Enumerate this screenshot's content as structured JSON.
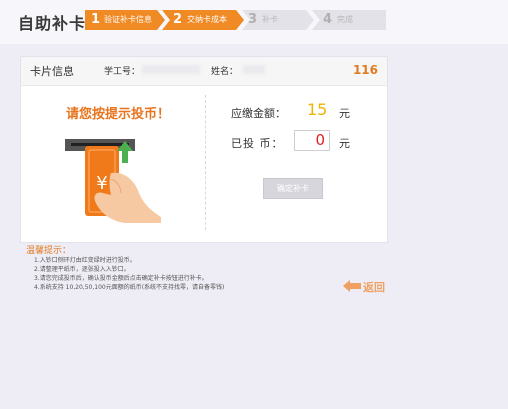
{
  "app": {
    "title": "自助补卡:"
  },
  "steps": [
    {
      "num": "1",
      "label": "验证补卡信息",
      "state": "done"
    },
    {
      "num": "2",
      "label": "交纳卡成本",
      "state": "current"
    },
    {
      "num": "3",
      "label": "补卡",
      "state": "todo"
    },
    {
      "num": "4",
      "label": "完成",
      "state": "todo"
    }
  ],
  "card_info": {
    "title": "卡片信息",
    "staff_id_label": "学工号：",
    "name_label": "姓名：",
    "countdown": "116"
  },
  "payment": {
    "prompt": "请您按提示投币！",
    "amount_due_label": "应缴金额：",
    "amount_due": "15",
    "amount_due_unit": "元",
    "inserted_label": "已投 币：",
    "inserted": "0",
    "inserted_unit": "元",
    "confirm_label": "确定补卡",
    "currency_symbol": "¥"
  },
  "tips": {
    "title": "温馨提示：",
    "items": [
      "1.入钞口侧环灯由红变绿时进行投币。",
      "2.请整理平纸币，逐张投入入钞口。",
      "3.请您完成投币后，确认投币金额后点击确定补卡按钮进行补卡。",
      "4.系统支持 10,20,50,100元面额的纸币(系统不支持找零，请自备零钱)"
    ]
  },
  "nav": {
    "back_label": "返回"
  },
  "colors": {
    "accent": "#f08a24",
    "amount_due": "#f0b400",
    "inserted": "#e02020",
    "step_inactive": "#e2e2e8"
  }
}
